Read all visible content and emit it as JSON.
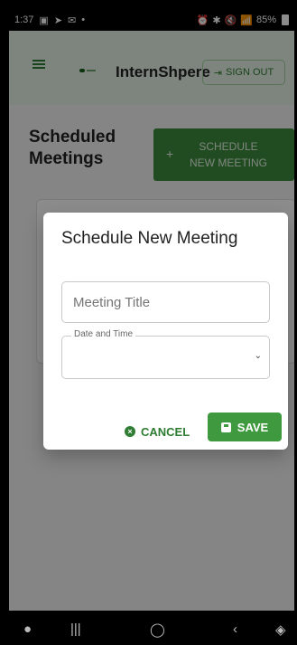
{
  "status_bar": {
    "time": "1:37",
    "left_icons": [
      "image-icon",
      "location-arrow-icon",
      "mail-icon"
    ],
    "right_text": "85%",
    "right_icons": [
      "alarm-icon",
      "bluetooth-icon",
      "mute-icon",
      "wifi-icon",
      "signal-icon",
      "battery-icon"
    ]
  },
  "app": {
    "brand": "InternShpere",
    "sign_out_label": "SIGN OUT"
  },
  "page": {
    "title_line1": "Scheduled",
    "title_line2": "Meetings",
    "schedule_button_line1": "SCHEDULE",
    "schedule_button_line2": "NEW MEETING"
  },
  "dialog": {
    "title": "Schedule New Meeting",
    "meeting_title_placeholder": "Meeting Title",
    "date_time_label": "Date and Time",
    "cancel_label": "CANCEL",
    "save_label": "SAVE"
  },
  "colors": {
    "accent": "#3f9a3f",
    "brand_green": "#2e7d32"
  }
}
